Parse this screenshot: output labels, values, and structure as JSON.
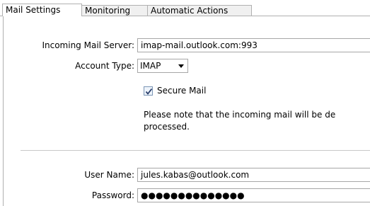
{
  "tabs": [
    {
      "label": "Mail Settings"
    },
    {
      "label": "Monitoring"
    },
    {
      "label": "Automatic Actions"
    }
  ],
  "incoming_server": {
    "label": "Incoming Mail Server:",
    "value": "imap-mail.outlook.com:993"
  },
  "account_type": {
    "label": "Account Type:",
    "value": "IMAP"
  },
  "secure_mail": {
    "label": "Secure Mail",
    "checked": true
  },
  "note": {
    "line1": "Please note that the incoming mail will be de",
    "line2": "processed."
  },
  "user_name": {
    "label": "User Name:",
    "value": "jules.kabas@outlook.com"
  },
  "password": {
    "label": "Password:",
    "value": "●●●●●●●●●●●●●●"
  }
}
